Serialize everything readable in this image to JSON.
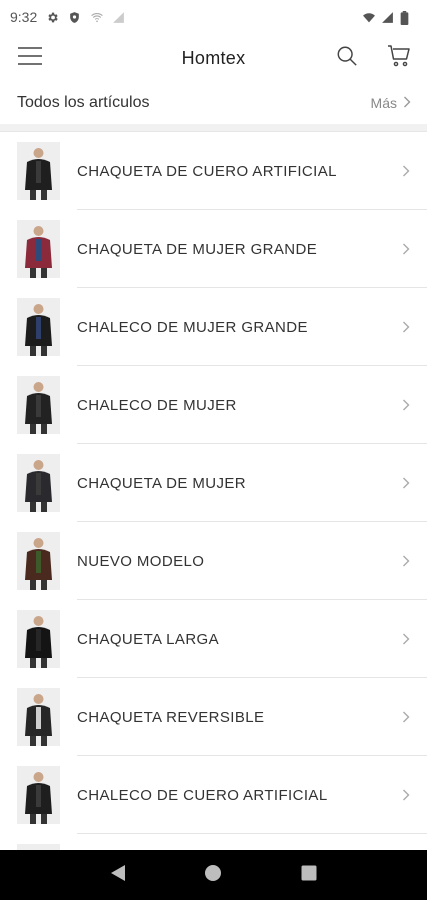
{
  "status_bar": {
    "time": "9:32",
    "icons_left": [
      "gear-icon",
      "shield-icon",
      "wifi-off-icon",
      "signal-off-icon"
    ],
    "icons_right": [
      "wifi-icon",
      "signal-icon",
      "battery-icon"
    ]
  },
  "app_bar": {
    "title": "Homtex",
    "icons": [
      "menu-icon",
      "search-icon",
      "cart-icon"
    ]
  },
  "section": {
    "title": "Todos los artículos",
    "more_label": "Más"
  },
  "items": [
    {
      "label": "CHAQUETA DE CUERO ARTIFICIAL",
      "thumb_color": "#1f1f1f",
      "accent": "#3a3a3a"
    },
    {
      "label": "CHAQUETA DE MUJER GRANDE",
      "thumb_color": "#8a2a3a",
      "accent": "#2d4a7a"
    },
    {
      "label": "CHALECO DE MUJER GRANDE",
      "thumb_color": "#1c1c1c",
      "accent": "#2d3f6a"
    },
    {
      "label": "CHALECO DE MUJER",
      "thumb_color": "#222222",
      "accent": "#3a3a3a"
    },
    {
      "label": "CHAQUETA DE MUJER",
      "thumb_color": "#2a2a2e",
      "accent": "#3a3a3a"
    },
    {
      "label": "NUEVO MODELO",
      "thumb_color": "#4a2a1e",
      "accent": "#3f5a2a"
    },
    {
      "label": "CHAQUETA LARGA",
      "thumb_color": "#141414",
      "accent": "#262626"
    },
    {
      "label": "CHAQUETA REVERSIBLE",
      "thumb_color": "#262626",
      "accent": "#cfcfcf"
    },
    {
      "label": "CHALECO DE CUERO ARTIFICIAL",
      "thumb_color": "#1e1e1e",
      "accent": "#3a3a3a"
    },
    {
      "label": "",
      "thumb_color": "#222222",
      "accent": "#3a3a3a"
    }
  ],
  "nav_bar": {
    "buttons": [
      "back-icon",
      "home-icon",
      "recents-icon"
    ]
  }
}
